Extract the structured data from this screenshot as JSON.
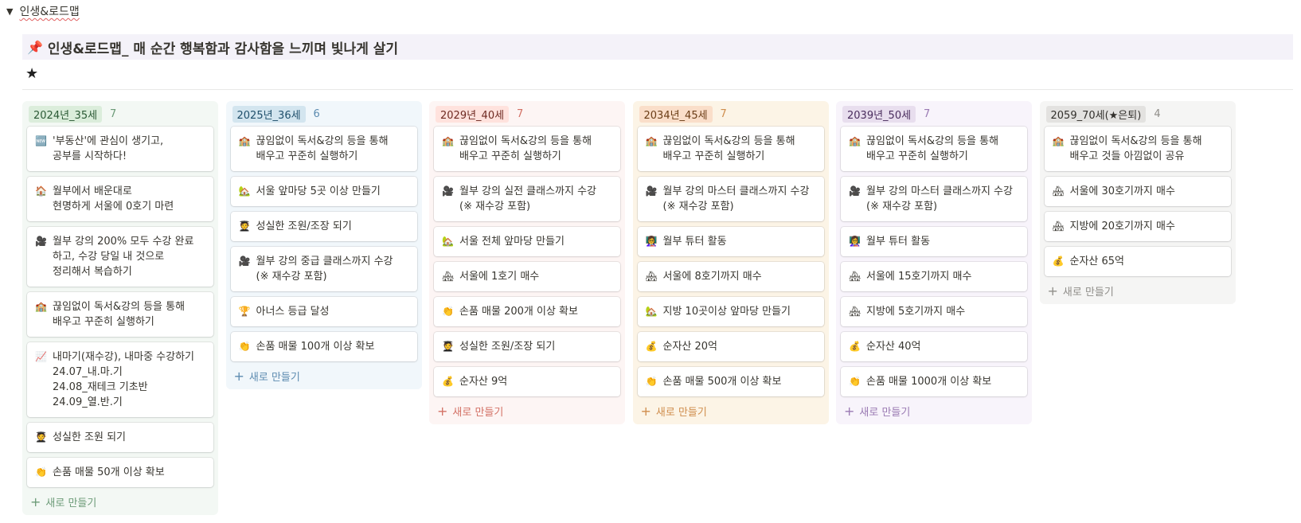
{
  "toggle": {
    "arrow": "▼",
    "title": "인생&로드맵"
  },
  "callout": {
    "icon": "📌",
    "text": "인생&로드맵_ 매 순간 행복함과 감사함을 느끼며 빛나게 살기"
  },
  "star": "★",
  "new_label": "새로 만들기",
  "columns": [
    {
      "tag": "2024년_35세",
      "count": "7",
      "bg": "#f3f8f4",
      "tag_bg": "#dbeddb",
      "tag_color": "#2b5a35",
      "accent": "#6c9b78",
      "cards": [
        {
          "icon": "🆕",
          "icon_name": "new-icon",
          "text": "'부동산'에 관심이 생기고,\n공부를 시작하다!"
        },
        {
          "icon": "🏠",
          "icon_name": "house-icon",
          "text": "월부에서 배운대로\n현명하게 서울에 0호기 마련"
        },
        {
          "icon": "🎥",
          "icon_name": "camera-icon",
          "text": "월부 강의 200% 모두 수강 완료\n하고, 수강 당일 내 것으로\n정리해서 복습하기"
        },
        {
          "icon": "🏫",
          "icon_name": "school-icon",
          "text": "끊임없이 독서&강의 등을 통해\n배우고 꾸준히 실행하기"
        },
        {
          "icon": "📈",
          "icon_name": "chart-icon",
          "text": "내마기(재수강), 내마중 수강하기\n24.07_내.마.기\n24.08_재테크 기초반\n24.09_열.반.기"
        },
        {
          "icon": "🧑‍🎓",
          "icon_name": "student-icon",
          "text": "성실한 조원 되기"
        },
        {
          "icon": "👏",
          "icon_name": "clap-icon",
          "text": "손품 매물 50개 이상 확보"
        }
      ]
    },
    {
      "tag": "2025년_36세",
      "count": "6",
      "bg": "#f1f7fb",
      "tag_bg": "#d3e5ef",
      "tag_color": "#1f4f6b",
      "accent": "#5c8bb0",
      "cards": [
        {
          "icon": "🏫",
          "icon_name": "school-icon",
          "text": "끊임없이 독서&강의 등을 통해\n배우고 꾸준히 실행하기"
        },
        {
          "icon": "🏡",
          "icon_name": "house-garden-icon",
          "text": "서울 앞마당 5곳 이상 만들기"
        },
        {
          "icon": "🧑‍🎓",
          "icon_name": "student-icon",
          "text": "성실한 조원/조장 되기"
        },
        {
          "icon": "🎥",
          "icon_name": "camera-icon",
          "text": "월부 강의 중급 클래스까지 수강\n(※ 재수강 포함)"
        },
        {
          "icon": "🏆",
          "icon_name": "trophy-icon",
          "text": "아너스 등급 달성"
        },
        {
          "icon": "👏",
          "icon_name": "clap-icon",
          "text": "손품 매물 100개 이상 확보"
        }
      ]
    },
    {
      "tag": "2029년_40세",
      "count": "7",
      "bg": "#fdf5f4",
      "tag_bg": "#ffe2dd",
      "tag_color": "#6e2a22",
      "accent": "#d37165",
      "cards": [
        {
          "icon": "🏫",
          "icon_name": "school-icon",
          "text": "끊임없이 독서&강의 등을 통해\n배우고 꾸준히 실행하기"
        },
        {
          "icon": "🎥",
          "icon_name": "camera-icon",
          "text": "월부 강의 실전 클래스까지 수강\n(※ 재수강 포함)"
        },
        {
          "icon": "🏡",
          "icon_name": "house-garden-icon",
          "text": "서울 전체 앞마당 만들기"
        },
        {
          "icon": "🏘",
          "icon_name": "houses-icon",
          "text": "서울에 1호기 매수"
        },
        {
          "icon": "👏",
          "icon_name": "clap-icon",
          "text": "손품 매물 200개 이상 확보"
        },
        {
          "icon": "🧑‍🎓",
          "icon_name": "student-icon",
          "text": "성실한 조원/조장 되기"
        },
        {
          "icon": "💰",
          "icon_name": "money-bag-icon",
          "text": "순자산 9억"
        }
      ]
    },
    {
      "tag": "2034년_45세",
      "count": "7",
      "bg": "#fcf4e6",
      "tag_bg": "#fadec9",
      "tag_color": "#6b3d16",
      "accent": "#cf8d4c",
      "cards": [
        {
          "icon": "🏫",
          "icon_name": "school-icon",
          "text": "끊임없이 독서&강의 등을 통해\n배우고 꾸준히 실행하기"
        },
        {
          "icon": "🎥",
          "icon_name": "camera-icon",
          "text": "월부 강의 마스터 클래스까지 수강\n(※ 재수강 포함)"
        },
        {
          "icon": "👩‍🏫",
          "icon_name": "teacher-icon",
          "text": "월부 튜터 활동"
        },
        {
          "icon": "🏘",
          "icon_name": "houses-icon",
          "text": "서울에 8호기까지 매수"
        },
        {
          "icon": "🏡",
          "icon_name": "house-garden-icon",
          "text": "지방 10곳이상 앞마당 만들기"
        },
        {
          "icon": "💰",
          "icon_name": "money-bag-icon",
          "text": "순자산 20억"
        },
        {
          "icon": "👏",
          "icon_name": "clap-icon",
          "text": "손품 매물 500개 이상 확보"
        }
      ]
    },
    {
      "tag": "2039년_50세",
      "count": "7",
      "bg": "#f8f4fb",
      "tag_bg": "#e8deee",
      "tag_color": "#4a2d5e",
      "accent": "#9a7ab3",
      "cards": [
        {
          "icon": "🏫",
          "icon_name": "school-icon",
          "text": "끊임없이 독서&강의 등을 통해\n배우고 꾸준히 실행하기"
        },
        {
          "icon": "🎥",
          "icon_name": "camera-icon",
          "text": "월부 강의 마스터 클래스까지 수강\n(※ 재수강 포함)"
        },
        {
          "icon": "👩‍🏫",
          "icon_name": "teacher-icon",
          "text": "월부 튜터 활동"
        },
        {
          "icon": "🏘",
          "icon_name": "houses-icon",
          "text": "서울에 15호기까지 매수"
        },
        {
          "icon": "🏘",
          "icon_name": "houses-icon",
          "text": "지방에 5호기까지 매수"
        },
        {
          "icon": "💰",
          "icon_name": "money-bag-icon",
          "text": "순자산 40억"
        },
        {
          "icon": "👏",
          "icon_name": "clap-icon",
          "text": "손품 매물 1000개 이상 확보"
        }
      ]
    },
    {
      "tag": "2059_70세(★은퇴)",
      "count": "4",
      "bg": "#f5f5f4",
      "tag_bg": "#e3e2e0",
      "tag_color": "#32302c",
      "accent": "#8f8d89",
      "cards": [
        {
          "icon": "🏫",
          "icon_name": "school-icon",
          "text": "끊임없이 독서&강의 등을 통해\n배우고 것들 아낌없이 공유"
        },
        {
          "icon": "🏘",
          "icon_name": "houses-icon",
          "text": "서울에 30호기까지 매수"
        },
        {
          "icon": "🏘",
          "icon_name": "houses-icon",
          "text": "지방에 20호기까지 매수"
        },
        {
          "icon": "💰",
          "icon_name": "money-bag-icon",
          "text": "순자산 65억"
        }
      ]
    }
  ]
}
